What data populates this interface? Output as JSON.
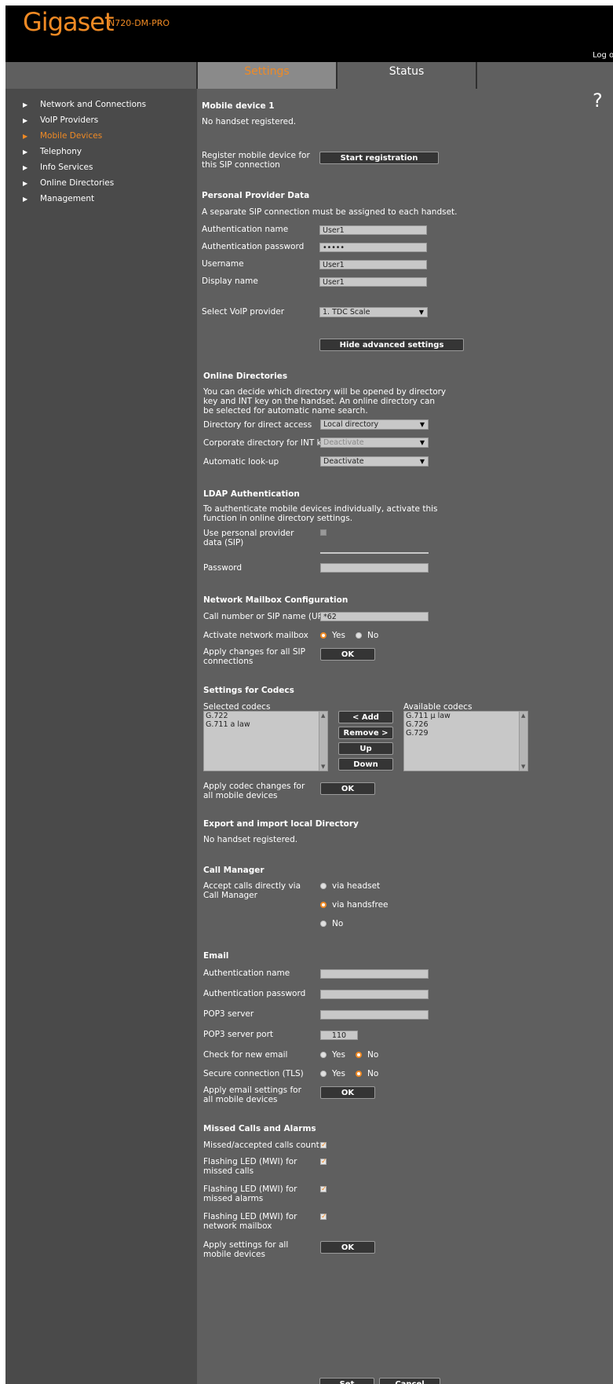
{
  "brand": {
    "logo": "Gigaset",
    "model": "N720-DM-PRO",
    "logout": "Log out"
  },
  "tabs": [
    {
      "label": "Settings"
    },
    {
      "label": "Status"
    }
  ],
  "help": "?",
  "sidebar": {
    "items": [
      {
        "label": "Network and Connections"
      },
      {
        "label": "VoIP Providers"
      },
      {
        "label": "Mobile Devices"
      },
      {
        "label": "Telephony"
      },
      {
        "label": "Info Services"
      },
      {
        "label": "Online Directories"
      },
      {
        "label": "Management"
      }
    ]
  },
  "mobile": {
    "title": "Mobile device 1",
    "status": "No handset registered.",
    "register_label": "Register mobile device for this SIP connection",
    "register_button": "Start registration"
  },
  "provider": {
    "title": "Personal Provider Data",
    "note": "A separate SIP connection must be assigned to each handset.",
    "auth_name_label": "Authentication name",
    "auth_name_value": "User1",
    "auth_pw_label": "Authentication password",
    "auth_pw_value": "•••••",
    "username_label": "Username",
    "username_value": "User1",
    "display_label": "Display name",
    "display_value": "User1",
    "voip_label": "Select VoIP provider",
    "voip_value": "1. TDC Scale",
    "advanced_button": "Hide advanced settings"
  },
  "directories": {
    "title": "Online Directories",
    "desc": "You can decide which directory will be opened by directory key and INT key on the handset. An online directory can be selected for automatic name search.",
    "direct_label": "Directory for direct access",
    "direct_value": "Local directory",
    "corp_label": "Corporate directory for INT key",
    "corp_value": "Deactivate",
    "lookup_label": "Automatic look-up",
    "lookup_value": "Deactivate"
  },
  "ldap": {
    "title": "LDAP Authentication",
    "desc": "To authenticate mobile devices individually, activate this function in online directory settings.",
    "personal_label": "Use personal provider data (SIP)",
    "password_label": "Password"
  },
  "mailbox": {
    "title": "Network Mailbox Configuration",
    "uri_label": "Call number or SIP name (URI)",
    "uri_value": "*62",
    "activate_label": "Activate network mailbox",
    "yes": "Yes",
    "no": "No",
    "apply_label": "Apply changes for all SIP connections",
    "ok": "OK"
  },
  "codecs": {
    "title": "Settings for Codecs",
    "selected_label": "Selected codecs",
    "available_label": "Available codecs",
    "selected": [
      "G.722",
      "G.711 a law"
    ],
    "available": [
      "G.711 μ law",
      "G.726",
      "G.729"
    ],
    "add": "< Add",
    "remove": "Remove >",
    "up": "Up",
    "down": "Down",
    "apply_label": "Apply codec changes for all mobile devices",
    "ok": "OK"
  },
  "export": {
    "title": "Export and import local Directory",
    "status": "No handset registered."
  },
  "callmanager": {
    "title": "Call Manager",
    "accept_label": "Accept calls directly via Call Manager",
    "opt1": "via headset",
    "opt2": "via handsfree",
    "opt3": "No"
  },
  "email": {
    "title": "Email",
    "auth_name_label": "Authentication name",
    "auth_pw_label": "Authentication password",
    "pop3_label": "POP3 server",
    "port_label": "POP3 server port",
    "port_value": "110",
    "check_label": "Check for new email",
    "tls_label": "Secure connection (TLS)",
    "yes": "Yes",
    "no": "No",
    "apply_label": "Apply email settings for all mobile devices",
    "ok": "OK"
  },
  "missed": {
    "title": "Missed Calls and Alarms",
    "count_label": "Missed/accepted calls count",
    "led_calls_label": "Flashing LED (MWI) for missed calls",
    "led_alarms_label": "Flashing LED (MWI) for missed alarms",
    "led_mailbox_label": "Flashing LED (MWI) for network mailbox",
    "apply_label": "Apply settings for all mobile devices",
    "ok": "OK"
  },
  "footer": {
    "set": "Set",
    "cancel": "Cancel"
  },
  "colors": {
    "accent": "#f08a24",
    "panel": "#5f5f5f",
    "sidebar": "#4a4a4a",
    "header": "#000000"
  },
  "icons": {
    "nav_arrow": "triangle-right-icon",
    "checkmark": "check-icon",
    "dropdown": "triangle-down-icon"
  }
}
